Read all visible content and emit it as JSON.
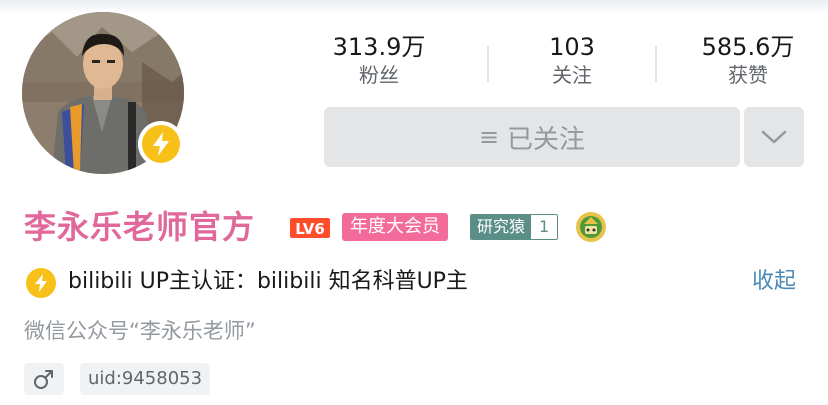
{
  "profile": {
    "name": "李永乐老师官方",
    "level_badge": "LV6",
    "vip_label": "年度大会员",
    "medal": {
      "name": "研究猿",
      "level": "1"
    },
    "certification": "bilibili  UP主认证：bilibili  知名科普UP主",
    "collapse_label": "收起",
    "signature": "微信公众号“李永乐老师”",
    "gender_icon": "male-icon",
    "uid": "uid:9458053"
  },
  "stats": {
    "followers": {
      "value": "313.9万",
      "label": "粉丝"
    },
    "following": {
      "value": "103",
      "label": "关注"
    },
    "likes": {
      "value": "585.6万",
      "label": "获赞"
    }
  },
  "actions": {
    "follow_label": "已关注",
    "follow_icon": "menu-icon",
    "more_icon": "chevron-down-icon"
  },
  "colors": {
    "name": "#e0689a",
    "vip_tag": "#f36b9a",
    "badge_yellow": "#f8c11a",
    "medal": "#5a8e86",
    "link": "#4a8ab4",
    "button_bg": "#e3e5e7"
  }
}
